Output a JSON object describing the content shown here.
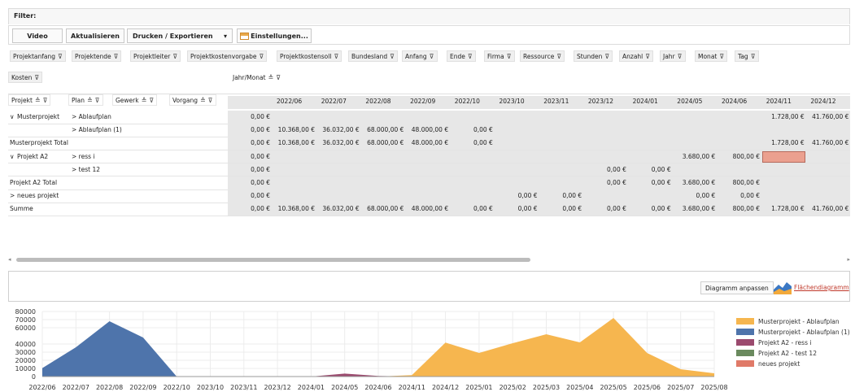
{
  "filter": {
    "label": "Filter:"
  },
  "toolbar": {
    "video": "Video",
    "refresh": "Aktualisieren",
    "print_export": "Drucken / Exportieren",
    "dropdown_caret": "▾",
    "settings": "Einstellungen..."
  },
  "filter_fields": [
    "Projektanfang",
    "Projektende",
    "Projektleiter",
    "Projektkostenvorgabe",
    "Projektkostensoll",
    "Bundesland",
    "Anfang",
    "Ende",
    "Firma",
    "Ressource",
    "Stunden",
    "Anzahl",
    "Jahr",
    "Monat",
    "Tag"
  ],
  "data_field": "Kosten",
  "column_field": "Jahr/Monat",
  "row_fields": [
    "Projekt",
    "Plan",
    "Gewerk",
    "Vorgang"
  ],
  "columns": [
    "2022/06",
    "2022/07",
    "2022/08",
    "2022/09",
    "2022/10",
    "2023/10",
    "2023/11",
    "2023/12",
    "2024/01",
    "2024/05",
    "2024/06",
    "2024/11",
    "2024/12"
  ],
  "rows": [
    {
      "level": 0,
      "expander": "∨",
      "project": "Musterprojekt",
      "plan": "> Ablaufplan",
      "first": "0,00 €",
      "values": [
        "",
        "",
        "",
        "",
        "",
        "",
        "",
        "",
        "",
        "",
        "",
        "1.728,00 €",
        "41.760,00 €"
      ],
      "highlight": -1
    },
    {
      "level": 1,
      "expander": "",
      "project": "",
      "plan": "> Ablaufplan (1)",
      "first": "0,00 €",
      "values": [
        "10.368,00 €",
        "36.032,00 €",
        "68.000,00 €",
        "48.000,00 €",
        "0,00 €",
        "",
        "",
        "",
        "",
        "",
        "",
        "",
        ""
      ],
      "highlight": -1
    },
    {
      "level": 0,
      "expander": "",
      "project": "Musterprojekt Total",
      "plan": "",
      "first": "0,00 €",
      "values": [
        "10.368,00 €",
        "36.032,00 €",
        "68.000,00 €",
        "48.000,00 €",
        "0,00 €",
        "",
        "",
        "",
        "",
        "",
        "",
        "1.728,00 €",
        "41.760,00 €"
      ],
      "highlight": -1
    },
    {
      "level": 0,
      "expander": "∨",
      "project": "Projekt A2",
      "plan": "> ress i",
      "first": "0,00 €",
      "values": [
        "",
        "",
        "",
        "",
        "",
        "",
        "",
        "",
        "",
        "3.680,00 €",
        "800,00 €",
        "",
        ""
      ],
      "highlight": 11
    },
    {
      "level": 1,
      "expander": "",
      "project": "",
      "plan": "> test 12",
      "first": "0,00 €",
      "values": [
        "",
        "",
        "",
        "",
        "",
        "",
        "",
        "0,00 €",
        "0,00 €",
        "",
        "",
        "",
        ""
      ],
      "highlight": -1
    },
    {
      "level": 0,
      "expander": "",
      "project": "Projekt A2 Total",
      "plan": "",
      "first": "0,00 €",
      "values": [
        "",
        "",
        "",
        "",
        "",
        "",
        "",
        "0,00 €",
        "0,00 €",
        "3.680,00 €",
        "800,00 €",
        "",
        ""
      ],
      "highlight": -1
    },
    {
      "level": 0,
      "expander": ">",
      "project": "neues projekt",
      "plan": "",
      "first": "0,00 €",
      "values": [
        "",
        "",
        "",
        "",
        "",
        "0,00 €",
        "0,00 €",
        "",
        "",
        "0,00 €",
        "0,00 €",
        "",
        ""
      ],
      "highlight": -1
    },
    {
      "level": 0,
      "expander": "",
      "project": "Summe",
      "plan": "",
      "first": "0,00 €",
      "values": [
        "10.368,00 €",
        "36.032,00 €",
        "68.000,00 €",
        "48.000,00 €",
        "0,00 €",
        "0,00 €",
        "0,00 €",
        "0,00 €",
        "0,00 €",
        "3.680,00 €",
        "800,00 €",
        "1.728,00 €",
        "41.760,00 €"
      ],
      "highlight": -1
    }
  ],
  "chart_controls": {
    "adjust": "Diagramm anpassen",
    "type_link": "Flächendiagramm"
  },
  "colors": {
    "grid_bg": "#e7e7e7",
    "highlight": "#eba08f",
    "link": "#c0392b"
  },
  "chart_data": {
    "type": "area",
    "x": [
      "2022/06",
      "2022/07",
      "2022/08",
      "2022/09",
      "2022/10",
      "2023/10",
      "2023/11",
      "2023/12",
      "2024/01",
      "2024/05",
      "2024/06",
      "2024/11",
      "2024/12",
      "2025/01",
      "2025/02",
      "2025/03",
      "2025/04",
      "2025/05",
      "2025/06",
      "2025/07",
      "2025/08"
    ],
    "y_ticks": [
      0,
      10000,
      20000,
      30000,
      40000,
      60000,
      70000,
      80000
    ],
    "ylim": [
      0,
      80000
    ],
    "series": [
      {
        "name": "Musterprojekt - Ablaufplan",
        "color": "#f6b64f",
        "values": [
          0,
          0,
          0,
          0,
          0,
          0,
          0,
          0,
          0,
          0,
          0,
          1728,
          41760,
          29000,
          41000,
          52000,
          42000,
          72000,
          29000,
          9000,
          4000
        ]
      },
      {
        "name": "Musterprojekt - Ablaufplan (1)",
        "color": "#4e74ab",
        "values": [
          10368,
          36032,
          68000,
          48000,
          0,
          0,
          0,
          0,
          0,
          0,
          0,
          0,
          0,
          0,
          0,
          0,
          0,
          0,
          0,
          0,
          0
        ]
      },
      {
        "name": "Projekt A2 - ress i",
        "color": "#9b4a6e",
        "values": [
          0,
          0,
          0,
          0,
          0,
          0,
          0,
          0,
          0,
          3680,
          800,
          0,
          0,
          0,
          0,
          0,
          0,
          0,
          0,
          0,
          0
        ]
      },
      {
        "name": "Projekt A2 - test 12",
        "color": "#6a8a5e",
        "values": [
          0,
          0,
          0,
          0,
          0,
          0,
          0,
          0,
          0,
          0,
          0,
          0,
          0,
          0,
          0,
          0,
          0,
          0,
          0,
          0,
          0
        ]
      },
      {
        "name": "neues projekt",
        "color": "#e07a68",
        "values": [
          0,
          0,
          0,
          0,
          0,
          0,
          0,
          0,
          0,
          0,
          0,
          0,
          0,
          0,
          0,
          0,
          0,
          0,
          0,
          0,
          0
        ]
      }
    ],
    "legend": "right"
  }
}
